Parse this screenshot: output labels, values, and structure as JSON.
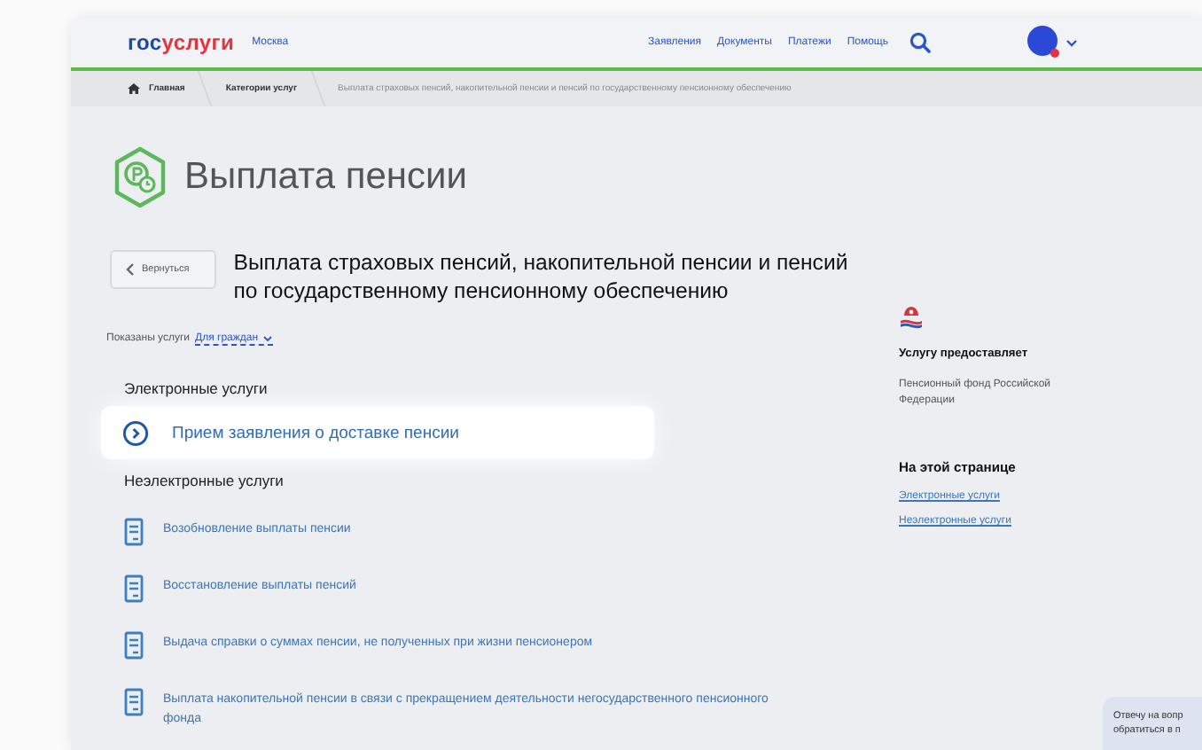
{
  "header": {
    "logo": {
      "prefix": "гос",
      "suffix": "услуги"
    },
    "city": "Москва",
    "nav": [
      "Заявления",
      "Документы",
      "Платежи",
      "Помощь"
    ]
  },
  "breadcrumbs": [
    "Главная",
    "Категории услуг",
    "Выплата страховых пенсий, накопительной пенсии и пенсий по государственному пенсионному обеспечению"
  ],
  "page_title": "Выплата пенсии",
  "back_button": "Вернуться",
  "service_title": "Выплата страховых пенсий, накопительной пенсии и пенсий по государственному пенсионному обеспечению",
  "filter": {
    "label": "Показаны услуги",
    "value": "Для граждан"
  },
  "sections": [
    {
      "title": "Электронные услуги",
      "items": [
        {
          "kind": "electronic",
          "label": "Прием заявления о доставке пенсии"
        }
      ]
    },
    {
      "title": "Неэлектронные услуги",
      "items": [
        {
          "kind": "document",
          "label": "Возобновление выплаты пенсии"
        },
        {
          "kind": "document",
          "label": "Восстановление выплаты пенсий"
        },
        {
          "kind": "document",
          "label": "Выдача справки о суммах пенсии, не полученных при жизни пенсионером"
        },
        {
          "kind": "document",
          "label": "Выплата накопительной пенсии в связи с прекращением деятельности негосударственного пенсионного фонда"
        }
      ]
    }
  ],
  "provider": {
    "heading": "Услугу предоставляет",
    "name": "Пенсионный фонд Российской Федерации"
  },
  "on_this_page": {
    "heading": "На этой странице",
    "links": [
      "Электронные услуги",
      "Неэлектронные услуги"
    ]
  },
  "chat_bubble": {
    "lines": [
      "Отвечу на вопр",
      "обратиться в п"
    ]
  }
}
